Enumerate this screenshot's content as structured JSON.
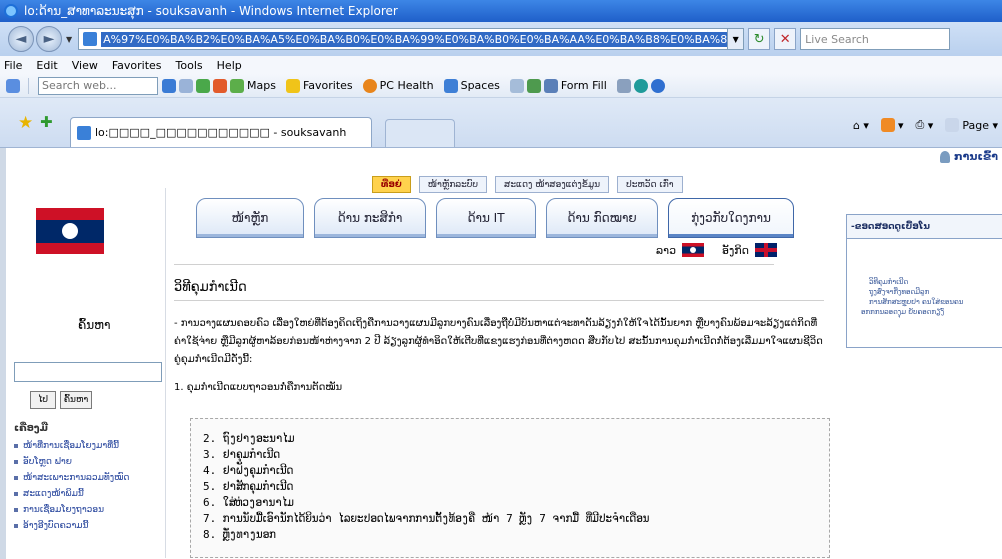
{
  "browser": {
    "title": "lo:ດ້ານ_ສາທາລະນະສຸກ - souksavanh - Windows Internet Explorer",
    "url": "A%97%E0%BA%B2%E0%BA%A5%E0%BA%B0%E0%BA%99%E0%BA%B0%E0%BA%AA%E0%BA%B8%E0%BA%81",
    "live_search": "Live Search",
    "tab_title": "lo:□□□□_□□□□□□□□□□□ - souksavanh",
    "menu": [
      "File",
      "Edit",
      "View",
      "Favorites",
      "Tools",
      "Help"
    ],
    "toolbar": {
      "search_web": "Search web...",
      "maps": "Maps",
      "favorites": "Favorites",
      "pc_health": "PC Health",
      "spaces": "Spaces",
      "form_fill": "Form Fill"
    },
    "command_bar": {
      "page": "Page"
    }
  },
  "page": {
    "user_link": "ການເຂົ້າ",
    "top_nav": [
      "ທີ່ອຍ່",
      "ໜ້າຫຼັກລະບົບ",
      "ສະແດງ ໜ້າສອງແຕ່ງຂໍ້ມູນ",
      "ປະຫວັດ ເກົ່າ"
    ],
    "left": {
      "search_label": "ຄົ້ນຫາ",
      "go_button": "ໄປ",
      "search_button": "ຄົ້ນຫາ",
      "section_title": "ເຄື່ອງມື",
      "links": [
        "ໜ້າທີ່ການເຊື່ອມໂຍງມາທີ່ນີ້",
        "ອັບໂຫຼດ ຟາຍ",
        "ໜ້າສະເພາະການລວມທັງໝົດ",
        "ສະແດງໜ້າພິມນີ້",
        "ການເຊື່ອມໂຍງຖາວອນ",
        "ອ້າງອີງບົດຄວາມນີ້"
      ]
    },
    "tabs": [
      "ໜ້າຫຼັກ",
      "ດ້ານ ກະສິກຳ",
      "ດ້ານ IT",
      "ດ້ານ ກົດໝາຍ",
      "ກຸ່ງວກັບໃດງການ"
    ],
    "lang": {
      "lao": "ລາວ",
      "english": "ອັງກິດ"
    },
    "heading": "ວິທີຄຸມກຳເນີດ",
    "paragraph": "- ການວາງແຜນຄອບຄົວ ເລື່ອງໃຫຍ່ທີ່ຕ້ອງຄິດເຖິງຄືການວາງແຜນມີລູກບາງຄົນເລື່ອງຖືບໍ່ມີບັນຫາແຕ່ຈະທາດັນລ້ຽງກໍໃຫ້ໃຈໄດ້ນັ້ນຍາກ ຫຼືບາງຄົນພ້ອມຈະລ້ຽງແຕ່ກິດທີ່ຄ່າໃຊ້ຈ່າຍ ຫຼືມີລູກຜູ້ຫາລ້ອຍກ່ອນໜ້າຫ່າງຈາກ 2 ປີ ລ້ຽງລູກຜູ້ທຳອິດໃຫ້ເຕີບທີ່ແຂງແຮງກ່ອນທີ່ຕ່າງຫດດ ສືບກັບໄປ ສະນັ້ນການຄຸມກຳເນີດກໍ່ຕ້ອງເລີ່ມມາໃຈແຜນຊີວິດຄູ່ຄຸມກຳເນີດມີດັ່ງນີ້:",
    "item1": "1. ຄຸມກຳເນີດແບບຖາວອນກໍ່ຄືການຕັດໝັນ",
    "list": [
      "2. ຖົງຢາງອະນາໄມ",
      "3. ຢາຄຸມກຳເນີດ",
      "4. ຢາຝັງຄຸມກຳເນີດ",
      "5. ຢາສັກຄຸມກຳເນີດ",
      "6. ໃສ່ຫ່ວງອານາໄມ",
      "7. ການນັບມື້ເອົານັກໄດ້ຍິນວ່າ ໄລຍະປອດໄພຈາກການຕັ້ງທ້ອງຄື ໜ້າ 7 ຫຼັງ 7 ຈາກມື້ ທີ່ມີປະຈຳເດືອນ",
      "8. ຫຼັ່ງທາງນອກ"
    ],
    "right_box": {
      "title": "-ຂອດສອດດູເບື້ອໂນ",
      "items": [
        "ວິທີຄຸມກຳເນີດ",
        "ຖຸງສົ່ງຈາກີ່ງທອດມີລູກ",
        "ການສັກສະຫຼຸບຢາ ຄນໃສ່ຂອນຄນ",
        "ອກກກນລອດງຸມ ຍັບຄອດກຽງົ່"
      ]
    }
  }
}
